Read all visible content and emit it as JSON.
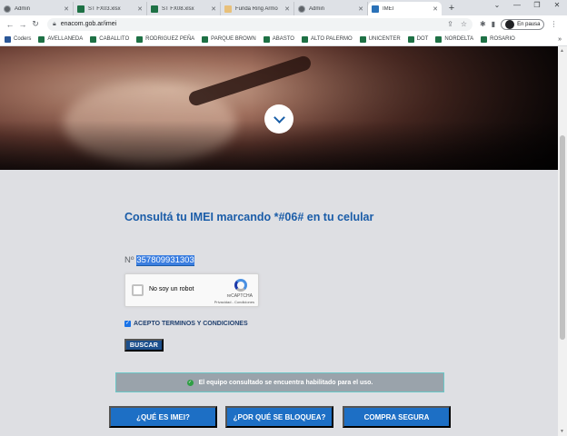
{
  "tabs": [
    {
      "title": "Admin",
      "icon": "globe-icon",
      "active": false
    },
    {
      "title": "ST FX03.xlsx",
      "icon": "excel-icon",
      "active": false
    },
    {
      "title": "ST FX08.xlsx",
      "icon": "excel-icon",
      "active": false
    },
    {
      "title": "Funda Ring Armo",
      "icon": "image-icon",
      "active": false
    },
    {
      "title": "Admin",
      "icon": "globe-icon",
      "active": false
    },
    {
      "title": "IMEI",
      "icon": "enacom-icon",
      "active": true
    }
  ],
  "address_bar": {
    "url": "enacom.gob.ar/imei",
    "profile_status": "En pausa"
  },
  "bookmarks": [
    "Coders",
    "AVELLANEDA",
    "CABALLITO",
    "RODRIGUEZ PEÑA",
    "PARQUE BROWN",
    "ABASTO",
    "ALTO PALERMO",
    "UNICENTER",
    "DOT",
    "NORDELTA",
    "ROSARIO"
  ],
  "page": {
    "heading": "Consultá tu IMEI marcando *#06# en tu celular",
    "imei_prefix": "Nº",
    "imei_value": "357809931303",
    "captcha": {
      "label": "No soy un robot",
      "brand": "reCAPTCHA",
      "terms": "Privacidad - Condiciones"
    },
    "accept_terms": "ACEPTO TERMINOS Y CONDICIONES",
    "search_button": "BUSCAR",
    "status_message": "El equipo consultado se encuentra habilitado para el uso.",
    "bottom_buttons": {
      "what_is_imei": "¿QUÉ ES IMEI?",
      "why_blocked": "¿POR QUÉ SE BLOQUEA?",
      "safe_purchase": "COMPRA SEGURA"
    }
  },
  "colors": {
    "heading": "#1a5ca8",
    "button_primary": "#1d6fc5",
    "search_button": "#1c4f8c",
    "status_bg": "#9aa3ab",
    "status_border": "#6bc7c7",
    "page_bg": "#dedfe3"
  }
}
